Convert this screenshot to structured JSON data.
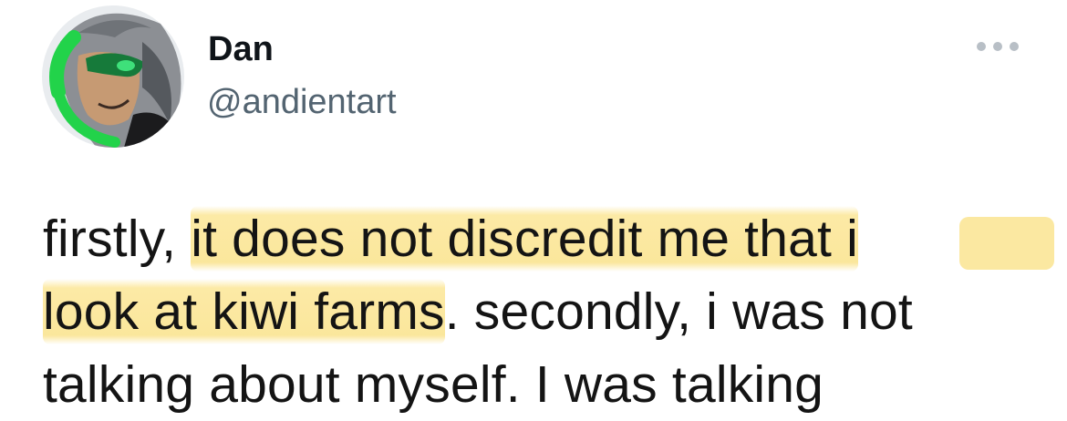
{
  "tweet": {
    "author": {
      "display_name": "Dan",
      "handle": "@andientart",
      "avatar_icon": "avatar-illustration-icon"
    },
    "more_icon": "more-options-icon",
    "text": {
      "line1_prefix": "firstly, ",
      "line1_highlight": "it does not discredit me that i",
      "line2_highlight": "look at kiwi farms",
      "line2_suffix": ". secondly, i was not",
      "line3": "talking about myself. I was talking"
    }
  },
  "colors": {
    "text": "#141414",
    "handle": "#536471",
    "highlight": "#FAE491",
    "avatar_green": "#22D34A"
  }
}
